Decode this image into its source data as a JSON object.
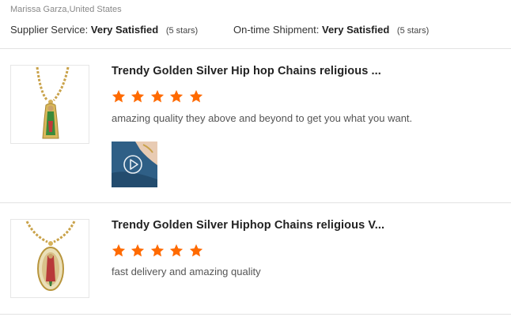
{
  "reviewer": "Marissa Garza,United States",
  "ratings": {
    "supplier": {
      "label": "Supplier Service:",
      "value": "Very Satisfied",
      "note": "(5 stars)"
    },
    "shipment": {
      "label": "On-time Shipment:",
      "value": "Very Satisfied",
      "note": "(5 stars)"
    }
  },
  "reviews": [
    {
      "title": "Trendy Golden Silver Hip hop Chains religious ...",
      "stars": 5,
      "comment": "amazing quality they above and beyond to get you what you want.",
      "has_media": true,
      "media_icon": "play-circle-icon"
    },
    {
      "title": "Trendy Golden Silver Hiphop Chains religious V...",
      "stars": 5,
      "comment": "fast delivery and amazing quality",
      "has_media": false
    }
  ],
  "colors": {
    "star": "#ff6a00",
    "divider": "#e3e3e3",
    "media_bg": "#3b6e98"
  }
}
